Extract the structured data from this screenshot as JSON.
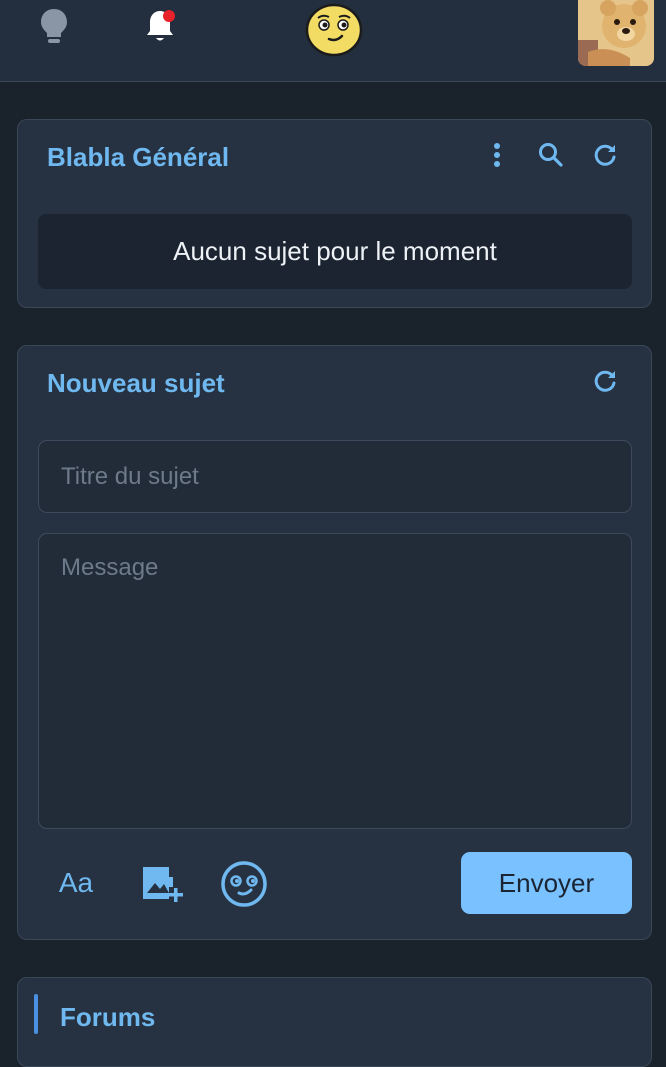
{
  "header": {
    "icons": [
      "lightbulb-icon",
      "bell-icon",
      "smiley-icon",
      "avatar"
    ],
    "notification_dot_color": "#e8222a"
  },
  "topic_card": {
    "title": "Blabla Général",
    "empty_message": "Aucun sujet pour le moment",
    "icons": [
      "more-vert-icon",
      "search-icon",
      "refresh-icon"
    ]
  },
  "new_topic": {
    "title": "Nouveau sujet",
    "title_placeholder": "Titre du sujet",
    "message_placeholder": "Message",
    "format_label": "Aa",
    "send_label": "Envoyer"
  },
  "forums": {
    "title": "Forums"
  },
  "colors": {
    "accent": "#6fb9f0",
    "button": "#79c2ff",
    "card_bg": "#263242",
    "page_bg": "#1a222c"
  }
}
